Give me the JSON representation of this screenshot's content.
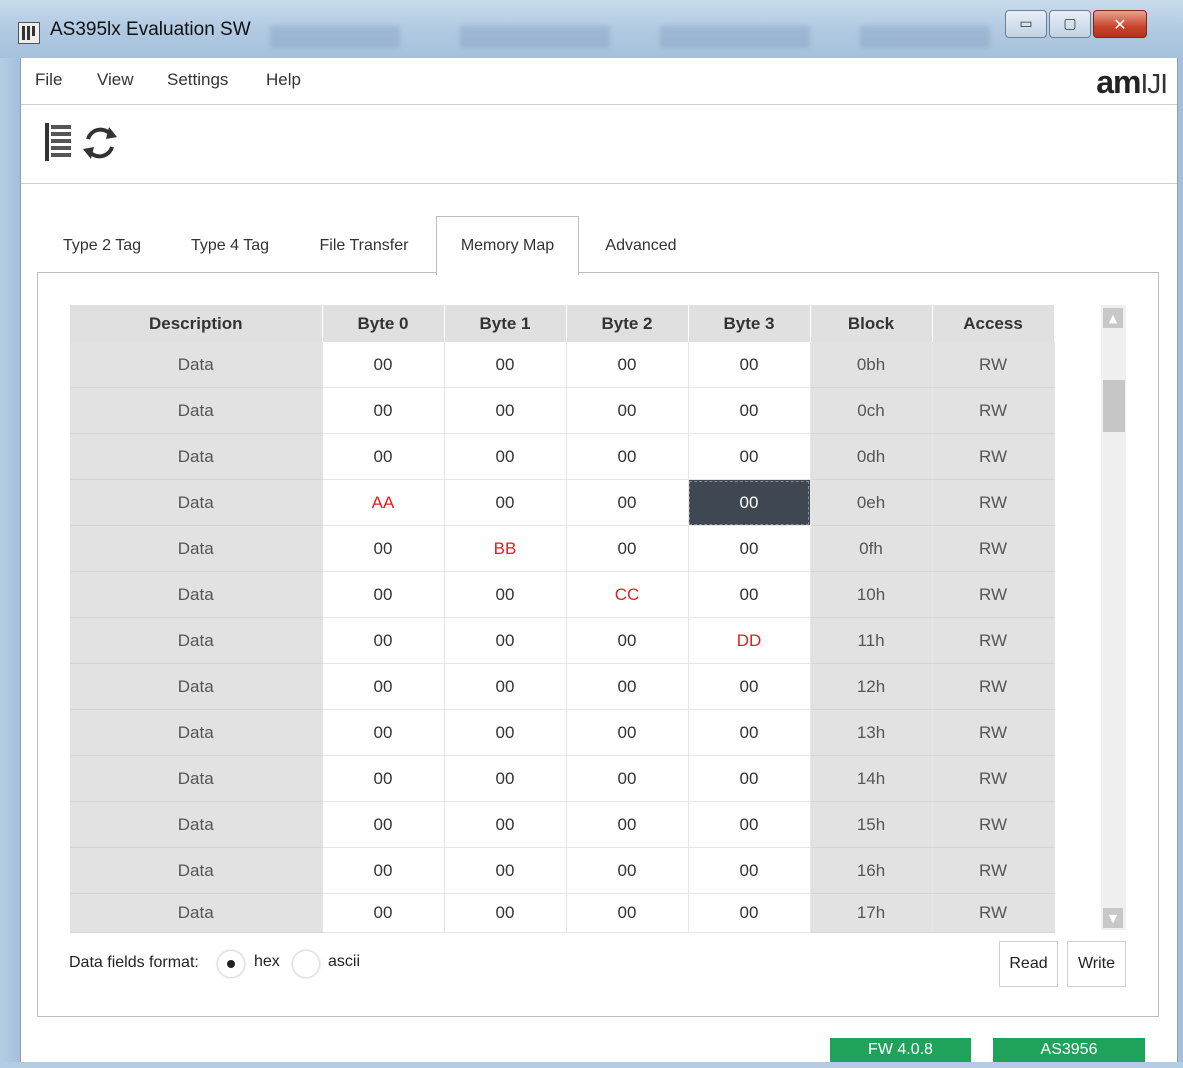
{
  "window": {
    "title": "AS395lx Evaluation SW",
    "minimize_glyph": "▭",
    "maximize_glyph": "▢",
    "close_glyph": "✕"
  },
  "menu": {
    "items": [
      "File",
      "View",
      "Settings",
      "Help"
    ]
  },
  "logo": {
    "part1": "am",
    "part2": "IJI"
  },
  "toolbar": {
    "icons": [
      "list-icon",
      "refresh-icon"
    ]
  },
  "tabs": [
    {
      "label": "Type 2 Tag",
      "active": false
    },
    {
      "label": "Type 4 Tag",
      "active": false
    },
    {
      "label": "File Transfer",
      "active": false
    },
    {
      "label": "Memory Map",
      "active": true
    },
    {
      "label": "Advanced",
      "active": false
    }
  ],
  "table": {
    "columns": [
      "Description",
      "Byte 0",
      "Byte 1",
      "Byte 2",
      "Byte 3",
      "Block",
      "Access"
    ],
    "rows": [
      {
        "desc": "Data",
        "b0": "00",
        "b1": "00",
        "b2": "00",
        "b3": "00",
        "block": "0bh",
        "access": "RW"
      },
      {
        "desc": "Data",
        "b0": "00",
        "b1": "00",
        "b2": "00",
        "b3": "00",
        "block": "0ch",
        "access": "RW"
      },
      {
        "desc": "Data",
        "b0": "00",
        "b1": "00",
        "b2": "00",
        "b3": "00",
        "block": "0dh",
        "access": "RW"
      },
      {
        "desc": "Data",
        "b0": "AA",
        "b1": "00",
        "b2": "00",
        "b3": "00",
        "block": "0eh",
        "access": "RW",
        "red": [
          "b0"
        ],
        "selected": "b3"
      },
      {
        "desc": "Data",
        "b0": "00",
        "b1": "BB",
        "b2": "00",
        "b3": "00",
        "block": "0fh",
        "access": "RW",
        "red": [
          "b1"
        ]
      },
      {
        "desc": "Data",
        "b0": "00",
        "b1": "00",
        "b2": "CC",
        "b3": "00",
        "block": "10h",
        "access": "RW",
        "red": [
          "b2"
        ]
      },
      {
        "desc": "Data",
        "b0": "00",
        "b1": "00",
        "b2": "00",
        "b3": "DD",
        "block": "11h",
        "access": "RW",
        "red": [
          "b3"
        ]
      },
      {
        "desc": "Data",
        "b0": "00",
        "b1": "00",
        "b2": "00",
        "b3": "00",
        "block": "12h",
        "access": "RW"
      },
      {
        "desc": "Data",
        "b0": "00",
        "b1": "00",
        "b2": "00",
        "b3": "00",
        "block": "13h",
        "access": "RW"
      },
      {
        "desc": "Data",
        "b0": "00",
        "b1": "00",
        "b2": "00",
        "b3": "00",
        "block": "14h",
        "access": "RW"
      },
      {
        "desc": "Data",
        "b0": "00",
        "b1": "00",
        "b2": "00",
        "b3": "00",
        "block": "15h",
        "access": "RW"
      },
      {
        "desc": "Data",
        "b0": "00",
        "b1": "00",
        "b2": "00",
        "b3": "00",
        "block": "16h",
        "access": "RW"
      },
      {
        "desc": "Data",
        "b0": "00",
        "b1": "00",
        "b2": "00",
        "b3": "00",
        "block": "17h",
        "access": "RW"
      }
    ]
  },
  "format": {
    "label": "Data fields format:",
    "options": [
      "hex",
      "ascii"
    ],
    "selected": "hex"
  },
  "buttons": {
    "read": "Read",
    "write": "Write"
  },
  "status": {
    "fw": "FW 4.0.8",
    "chip": "AS3956"
  },
  "colors": {
    "status_green": "#1fa25a",
    "highlight_red": "#e02020",
    "selected_cell": "#3f4752"
  }
}
